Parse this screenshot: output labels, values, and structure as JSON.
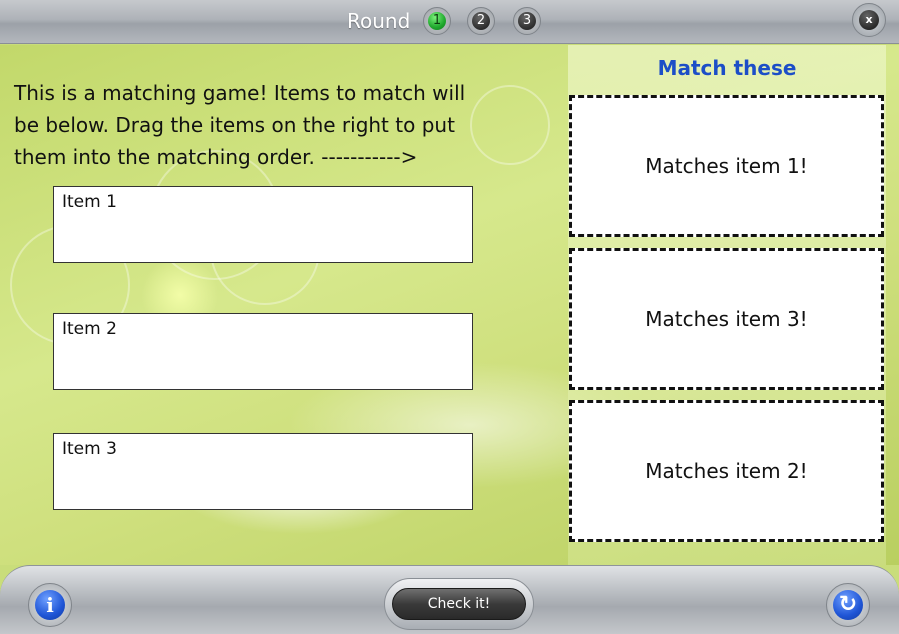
{
  "titlebar": {
    "round_label": "Round",
    "rounds": [
      "1",
      "2",
      "3"
    ],
    "active_round": "1",
    "close_label": "x"
  },
  "instructions": {
    "line1": "This is a matching game! Items to match will",
    "line2": "be below. Drag the items on the right to put",
    "line3": "them into the matching order. ----------->"
  },
  "items": [
    "Item 1",
    "Item 2",
    "Item 3"
  ],
  "match_panel": {
    "title": "Match these",
    "matches": [
      "Matches item 1!",
      "Matches item 3!",
      "Matches item 2!"
    ]
  },
  "bottombar": {
    "info_icon": "info-icon",
    "check_label": "Check it!",
    "refresh_icon": "refresh-icon"
  },
  "colors": {
    "accent_title": "#1c4ec7",
    "active_round": "#1fa82d",
    "background": "#c9dd7a"
  }
}
